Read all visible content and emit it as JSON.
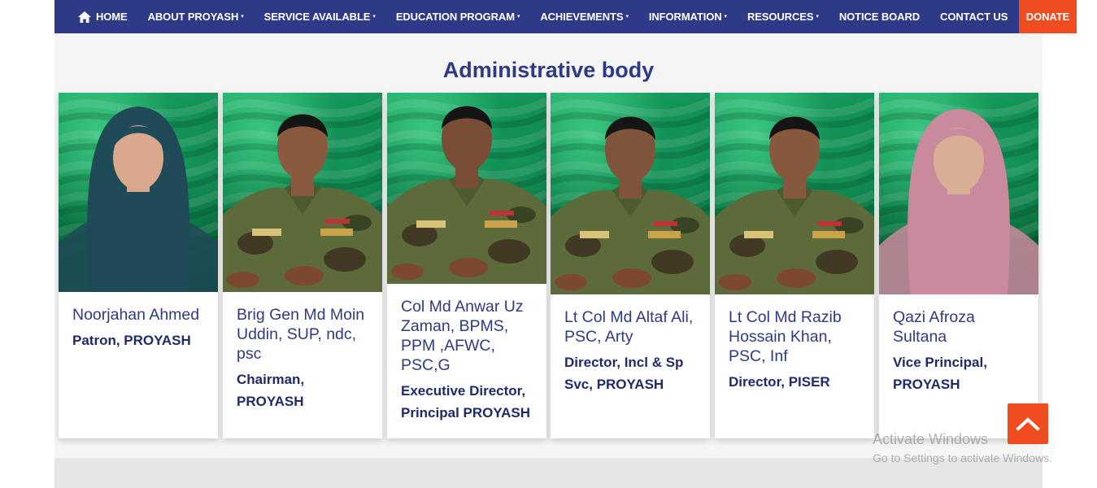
{
  "nav": {
    "items": [
      {
        "label": "HOME",
        "icon": "home-icon",
        "dropdown": false
      },
      {
        "label": "ABOUT PROYASH",
        "dropdown": true
      },
      {
        "label": "SERVICE AVAILABLE",
        "dropdown": true
      },
      {
        "label": "EDUCATION PROGRAM",
        "dropdown": true
      },
      {
        "label": "ACHIEVEMENTS",
        "dropdown": true
      },
      {
        "label": "INFORMATION",
        "dropdown": true
      },
      {
        "label": "RESOURCES",
        "dropdown": true
      },
      {
        "label": "NOTICE BOARD",
        "dropdown": false
      },
      {
        "label": "CONTACT US",
        "dropdown": false
      },
      {
        "label": "DONATE",
        "dropdown": false
      }
    ],
    "caret": "▾"
  },
  "section": {
    "title": "Administrative body"
  },
  "members": [
    {
      "name": "Noorjahan Ahmed",
      "role": "Patron, PROYASH",
      "attire": "hijab",
      "scarf": "#1f4a57",
      "face": "#d9a88d"
    },
    {
      "name": "Brig Gen Md Moin Uddin, SUP, ndc, psc",
      "role": "Chairman, PROYASH",
      "attire": "uniform",
      "face": "#8a5a3f"
    },
    {
      "name": "Col Md Anwar Uz Zaman, BPMS, PPM ,AFWC, PSC,G",
      "role": "Executive Director, Principal PROYASH",
      "attire": "uniform",
      "face": "#7a4e36"
    },
    {
      "name": "Lt Col Md Altaf Ali, PSC, Arty",
      "role": "Director, Incl & Sp Svc, PROYASH",
      "attire": "uniform",
      "face": "#80543a"
    },
    {
      "name": "Lt Col Md Razib Hossain Khan, PSC, Inf",
      "role": "Director, PISER",
      "attire": "uniform",
      "face": "#86593d"
    },
    {
      "name": "Qazi Afroza Sultana",
      "role": "Vice Principal, PROYASH",
      "attire": "hijab",
      "scarf": "#c98a9d",
      "face": "#d8ae95"
    }
  ],
  "colors": {
    "nav_bg": "#2e3a87",
    "donate_bg": "#ef4d1f",
    "title": "#2e3a87",
    "scroll_top_bg": "#ef4d1f"
  },
  "scroll_top": {
    "icon": "chevron-up-icon"
  },
  "watermark": {
    "line1": "Activate Windows",
    "line2": "Go to Settings to activate Windows."
  }
}
